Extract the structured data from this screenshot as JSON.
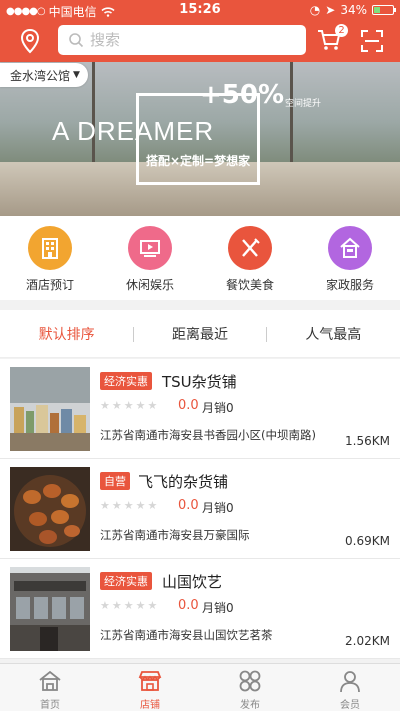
{
  "status_bar": {
    "carrier": "中国电信",
    "time": "15:26",
    "battery": "34%",
    "battery_level": 0.34
  },
  "header": {
    "search_placeholder": "搜索",
    "cart_count": "2"
  },
  "location": {
    "label": "金水湾公馆"
  },
  "banner": {
    "headline": "A DREAMER",
    "plus": "+50%",
    "plus_sub": "空间提升",
    "subtitle": "搭配×定制=梦想家"
  },
  "categories": [
    {
      "label": "酒店预订",
      "icon": "hotel-icon",
      "color": "#f2a530"
    },
    {
      "label": "休闲娱乐",
      "icon": "entertainment-icon",
      "color": "#ef6a8a"
    },
    {
      "label": "餐饮美食",
      "icon": "dining-icon",
      "color": "#e9553d"
    },
    {
      "label": "家政服务",
      "icon": "housekeeping-icon",
      "color": "#b266e0"
    }
  ],
  "sort_tabs": [
    {
      "label": "默认排序",
      "active": true
    },
    {
      "label": "距离最近",
      "active": false
    },
    {
      "label": "人气最高",
      "active": false
    }
  ],
  "shops": [
    {
      "tag": "经济实惠",
      "name": "TSU杂货铺",
      "score": "0.0",
      "sales": "月销0",
      "address": "江苏省南通市海安县书香园小区(中坝南路)",
      "distance": "1.56KM"
    },
    {
      "tag": "自营",
      "name": "飞飞的杂货铺",
      "score": "0.0",
      "sales": "月销0",
      "address": "江苏省南通市海安县万豪国际",
      "distance": "0.69KM"
    },
    {
      "tag": "经济实惠",
      "name": "山国饮艺",
      "score": "0.0",
      "sales": "月销0",
      "address": "江苏省南通市海安县山国饮艺茗茶",
      "distance": "2.02KM"
    }
  ],
  "tabbar": [
    {
      "label": "首页",
      "icon": "home-icon"
    },
    {
      "label": "店铺",
      "icon": "store-icon",
      "active": true
    },
    {
      "label": "发布",
      "icon": "publish-icon"
    },
    {
      "label": "会员",
      "icon": "member-icon"
    }
  ],
  "colors": {
    "accent": "#e9553d"
  }
}
